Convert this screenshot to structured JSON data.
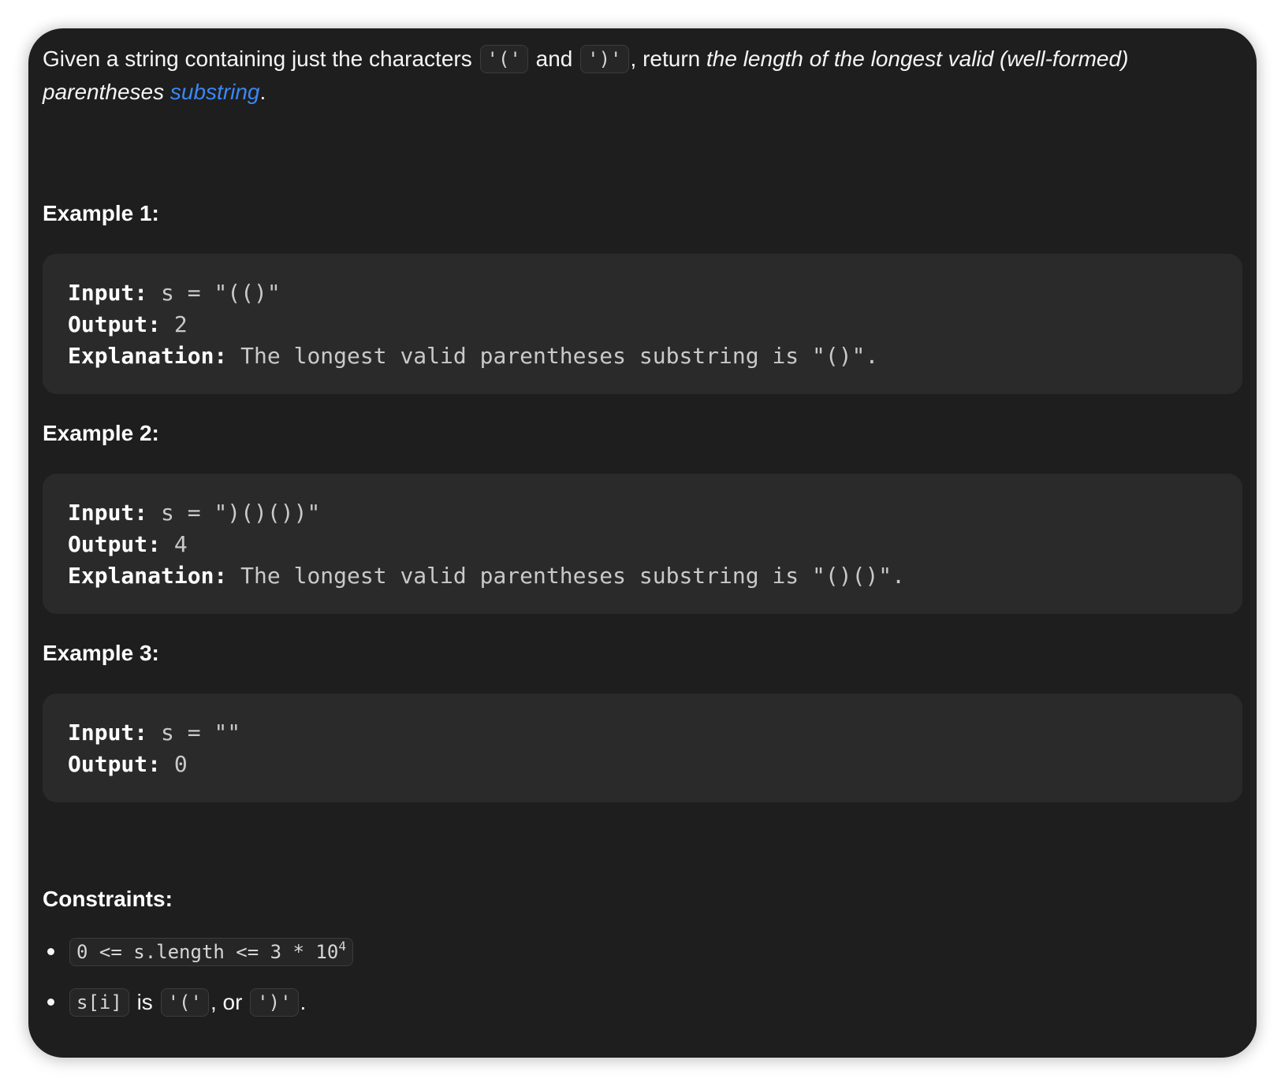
{
  "description": {
    "part1": "Given a string containing just the characters ",
    "open_paren": "'('",
    "and": " and ",
    "close_paren": "')'",
    "part2": ", return ",
    "italic": "the length of the longest valid (well-formed) parentheses ",
    "link": "substring",
    "end": "."
  },
  "examples": [
    {
      "title": "Example 1:",
      "input_label": "Input:",
      "input_value": " s = \"(()\"",
      "output_label": "Output:",
      "output_value": " 2",
      "explanation_label": "Explanation:",
      "explanation_value": " The longest valid parentheses substring is \"()\"."
    },
    {
      "title": "Example 2:",
      "input_label": "Input:",
      "input_value": " s = \")()())\"",
      "output_label": "Output:",
      "output_value": " 4",
      "explanation_label": "Explanation:",
      "explanation_value": " The longest valid parentheses substring is \"()()\"."
    },
    {
      "title": "Example 3:",
      "input_label": "Input:",
      "input_value": " s = \"\"",
      "output_label": "Output:",
      "output_value": " 0"
    }
  ],
  "constraints": {
    "title": "Constraints:",
    "c1_code": "0 <= s.length <= 3 * 10",
    "c1_exp": "4",
    "c2_code": "s[i]",
    "c2_is": " is ",
    "c2_open": "'('",
    "c2_or": ", or ",
    "c2_close": "')'",
    "c2_end": "."
  },
  "colors": {
    "background": "#1e1e1e",
    "code_block": "#2a2a2a",
    "link": "#3a87f5"
  }
}
